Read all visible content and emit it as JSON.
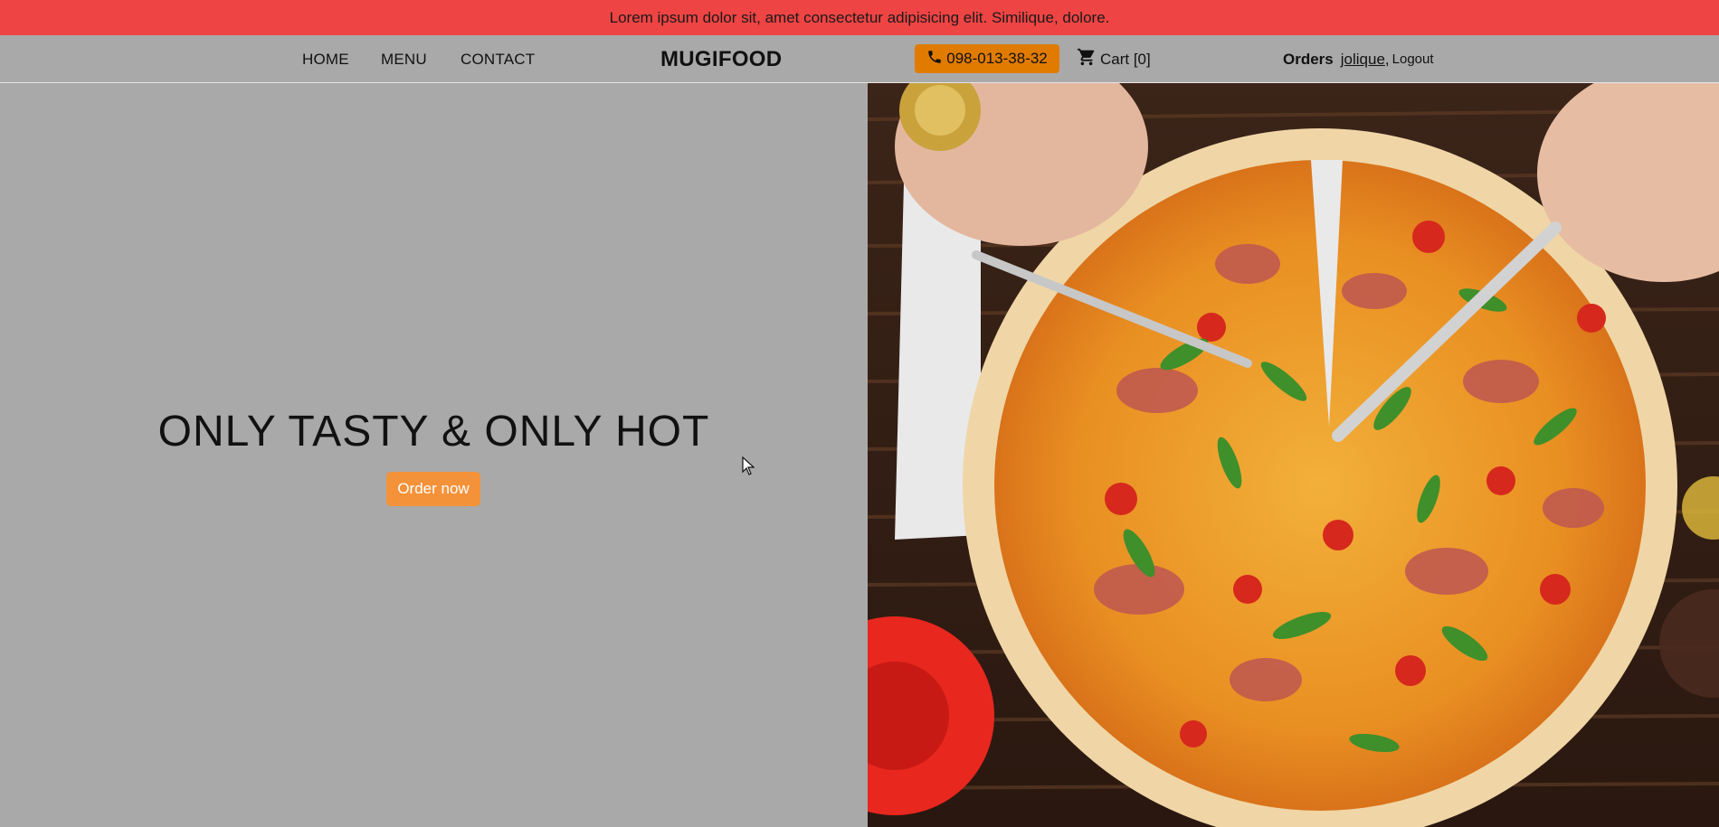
{
  "announcement": {
    "text": "Lorem ipsum dolor sit, amet consectetur adipisicing elit. Similique, dolore."
  },
  "nav": {
    "home": "HOME",
    "menu": "MENU",
    "contact": "CONTACT"
  },
  "logo": "MUGIFOOD",
  "phone": {
    "number": "098-013-38-32",
    "icon": "phone-icon"
  },
  "cart": {
    "label": "Cart [0]",
    "icon": "cart-icon"
  },
  "account": {
    "orders": "Orders",
    "username": "jolique",
    "comma": ",",
    "logout": "Logout"
  },
  "hero": {
    "title": "ONLY TASTY & ONLY HOT",
    "button": "Order now",
    "image": "pizza-photo"
  },
  "colors": {
    "announcement_bg": "#ef4444",
    "page_bg": "#a9a9a9",
    "phone_bg": "#e07b00",
    "button_bg": "#f4923a"
  }
}
